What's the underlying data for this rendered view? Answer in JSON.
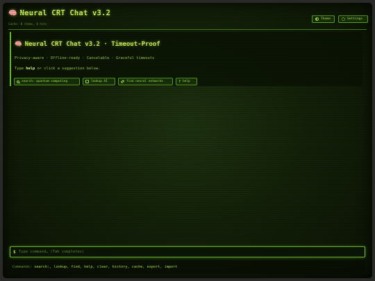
{
  "header": {
    "title": "Neural CRT Chat v3.2",
    "title_emoji": "🧠",
    "cache_status": "Cache: 0 items, 0 hits",
    "theme_label": "Theme",
    "settings_label": "Settings"
  },
  "welcome": {
    "title": "Neural CRT Chat v3.2 · Timeout-Proof",
    "title_emoji": "🧠",
    "features": "Privacy-aware · Offline-ready · Cancelable · Graceful timeouts",
    "hint_prefix": "Type",
    "hint_keyword": "help",
    "hint_suffix": "or click a suggestion below.",
    "suggestions": [
      {
        "label": "search: quantum computing",
        "icon": "search-icon"
      },
      {
        "label": "lookup AI",
        "icon": "lookup-icon"
      },
      {
        "label": "find neural networks",
        "icon": "link-icon"
      },
      {
        "label": "help",
        "icon": "question-icon"
      }
    ]
  },
  "command": {
    "prompt": "$",
    "placeholder": "Type command… (Tab completes)",
    "help_label": "Commands:",
    "help_list": "search:, lookup, find, help, clear, history, cache, export, import"
  },
  "colors": {
    "accent": "#c8f050",
    "border": "#5aa024",
    "background": "#142109"
  }
}
